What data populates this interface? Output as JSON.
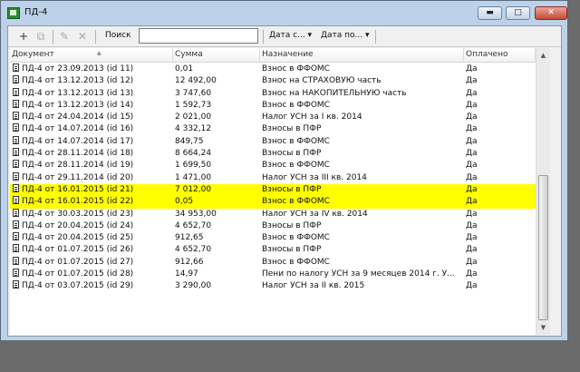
{
  "window": {
    "title": "ПД-4",
    "min_glyph": "▬",
    "max_glyph": "□",
    "close_glyph": "✕"
  },
  "toolbar": {
    "add_glyph": "+",
    "copy_glyph": "⧉",
    "edit_glyph": "✎",
    "delete_glyph": "✕",
    "search_label": "Поиск",
    "search_value": "",
    "date_from_label": "Дата с... ▾",
    "date_to_label": "Дата по... ▾"
  },
  "table": {
    "columns": [
      "Документ",
      "Сумма",
      "Назначение",
      "Оплачено"
    ],
    "rows": [
      {
        "doc": "ПД-4 от 23.09.2013 (id 11)",
        "sum": "0,01",
        "purpose": "Взнос в ФФОМС",
        "paid": "Да",
        "highlight": false
      },
      {
        "doc": "ПД-4 от 13.12.2013 (id 12)",
        "sum": "12 492,00",
        "purpose": "Взнос на СТРАХОВУЮ часть",
        "paid": "Да",
        "highlight": false
      },
      {
        "doc": "ПД-4 от 13.12.2013 (id 13)",
        "sum": "3 747,60",
        "purpose": "Взнос на НАКОПИТЕЛЬНУЮ часть",
        "paid": "Да",
        "highlight": false
      },
      {
        "doc": "ПД-4 от 13.12.2013 (id 14)",
        "sum": "1 592,73",
        "purpose": "Взнос в ФФОМС",
        "paid": "Да",
        "highlight": false
      },
      {
        "doc": "ПД-4 от 24.04.2014 (id 15)",
        "sum": "2 021,00",
        "purpose": "Налог УСН за I кв. 2014",
        "paid": "Да",
        "highlight": false
      },
      {
        "doc": "ПД-4 от 14.07.2014 (id 16)",
        "sum": "4 332,12",
        "purpose": "Взносы в ПФР",
        "paid": "Да",
        "highlight": false
      },
      {
        "doc": "ПД-4 от 14.07.2014 (id 17)",
        "sum": "849,75",
        "purpose": "Взнос в ФФОМС",
        "paid": "Да",
        "highlight": false
      },
      {
        "doc": "ПД-4 от 28.11.2014 (id 18)",
        "sum": "8 664,24",
        "purpose": "Взносы в ПФР",
        "paid": "Да",
        "highlight": false
      },
      {
        "doc": "ПД-4 от 28.11.2014 (id 19)",
        "sum": "1 699,50",
        "purpose": "Взнос в ФФОМС",
        "paid": "Да",
        "highlight": false
      },
      {
        "doc": "ПД-4 от 29.11.2014 (id 20)",
        "sum": "1 471,00",
        "purpose": "Налог УСН за III кв. 2014",
        "paid": "Да",
        "highlight": false
      },
      {
        "doc": "ПД-4 от 16.01.2015 (id 21)",
        "sum": "7 012,00",
        "purpose": "Взносы в ПФР",
        "paid": "Да",
        "highlight": true
      },
      {
        "doc": "ПД-4 от 16.01.2015 (id 22)",
        "sum": "0,05",
        "purpose": "Взнос в ФФОМС",
        "paid": "Да",
        "highlight": true
      },
      {
        "doc": "ПД-4 от 30.03.2015 (id 23)",
        "sum": "34 953,00",
        "purpose": "Налог УСН за IV кв. 2014",
        "paid": "Да",
        "highlight": false
      },
      {
        "doc": "ПД-4 от 20.04.2015 (id 24)",
        "sum": "4 652,70",
        "purpose": "Взносы в ПФР",
        "paid": "Да",
        "highlight": false
      },
      {
        "doc": "ПД-4 от 20.04.2015 (id 25)",
        "sum": "912,65",
        "purpose": "Взнос в ФФОМС",
        "paid": "Да",
        "highlight": false
      },
      {
        "doc": "ПД-4 от 01.07.2015 (id 26)",
        "sum": "4 652,70",
        "purpose": "Взносы в ПФР",
        "paid": "Да",
        "highlight": false
      },
      {
        "doc": "ПД-4 от 01.07.2015 (id 27)",
        "sum": "912,66",
        "purpose": "Взнос в ФФОМС",
        "paid": "Да",
        "highlight": false
      },
      {
        "doc": "ПД-4 от 01.07.2015 (id 28)",
        "sum": "14,97",
        "purpose": "Пени по налогу УСН за 9 месяцев 2014 г. У...",
        "paid": "Да",
        "highlight": false
      },
      {
        "doc": "ПД-4 от 03.07.2015 (id 29)",
        "sum": "3 290,00",
        "purpose": "Налог УСН за II кв. 2015",
        "paid": "Да",
        "highlight": false
      }
    ]
  },
  "colors": {
    "highlight": "#ffff00",
    "frame": "#bcd2e8",
    "desktop": "#6b6b6b"
  }
}
